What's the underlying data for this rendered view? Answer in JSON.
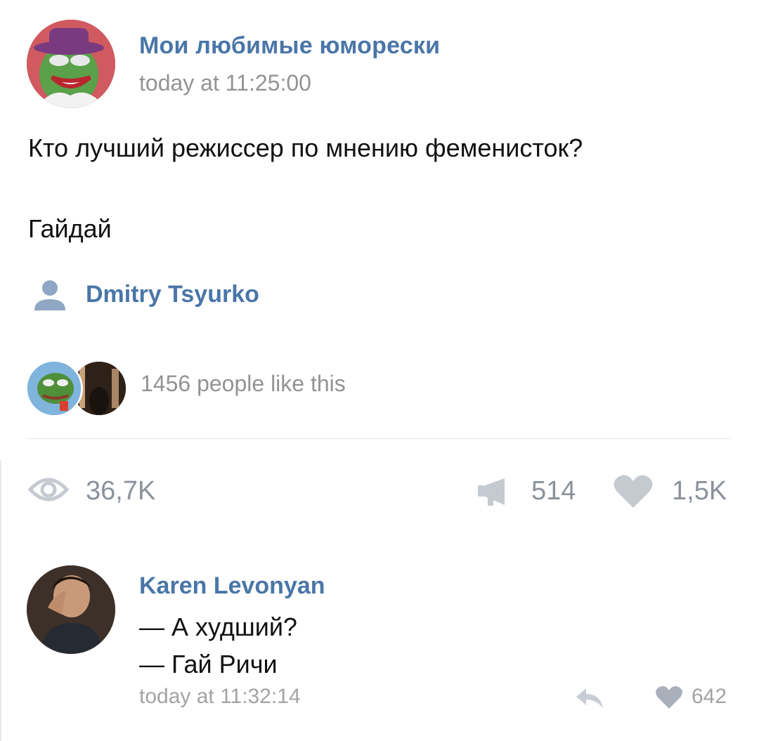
{
  "post": {
    "group_name": "Мои любимые юморески",
    "time": "today at 11:25:00",
    "text_line1": "Кто лучший режиссер по мнению феменисток?",
    "text_line2": "Гайдай",
    "author_name": "Dmitry Tsyurko",
    "likes_text": "1456 people like this"
  },
  "stats": {
    "views": "36,7K",
    "shares": "514",
    "likes": "1,5K"
  },
  "comment": {
    "author": "Karen Levonyan",
    "line1": "— А худший?",
    "line2": "— Гай Ричи",
    "time": "today at 11:32:14",
    "likes": "642"
  },
  "colors": {
    "accent": "#4a76a8",
    "muted": "#939393"
  },
  "icons": [
    "user-icon",
    "eye-icon",
    "megaphone-icon",
    "heart-icon",
    "reply-icon"
  ]
}
